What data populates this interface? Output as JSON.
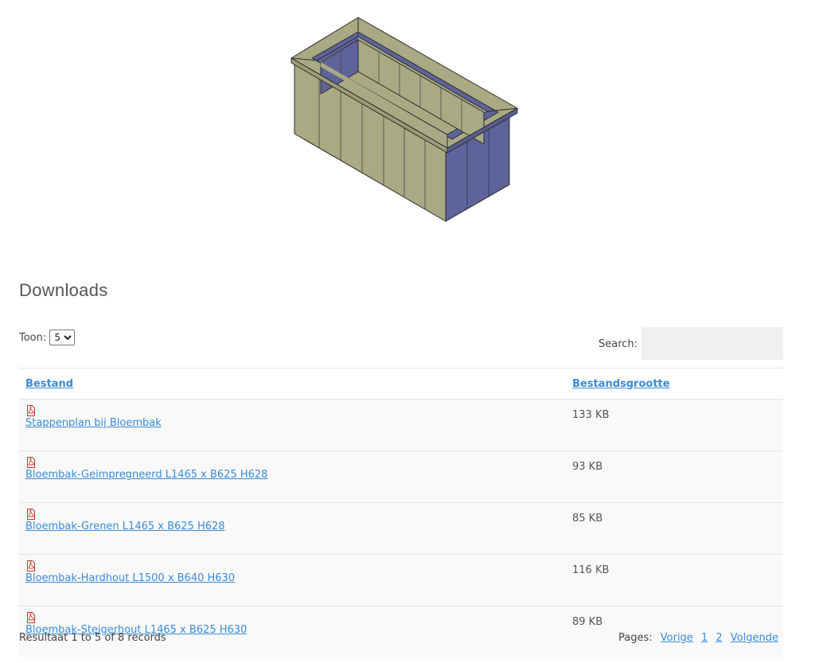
{
  "figure": {
    "name": "bloembak-3d-drawing"
  },
  "section": {
    "title": "Downloads"
  },
  "controls": {
    "toon_label": "Toon:",
    "toon_value": "5",
    "search_label": "Search:",
    "search_placeholder": ""
  },
  "table": {
    "headers": {
      "file": "Bestand",
      "size": "Bestandsgrootte"
    },
    "rows": [
      {
        "name": "Stappenplan bij Bloembak",
        "size": "133 KB",
        "icon": "pdf-icon"
      },
      {
        "name": "Bloembak-Geimpregneerd L1465 x B625 H628",
        "size": "93 KB",
        "icon": "pdf-icon"
      },
      {
        "name": "Bloembak-Grenen L1465 x B625 H628",
        "size": "85 KB",
        "icon": "pdf-icon"
      },
      {
        "name": "Bloembak-Hardhout L1500 x B640 H630",
        "size": "116 KB",
        "icon": "pdf-icon"
      },
      {
        "name": "Bloembak-Steigerhout L1465 x B625 H630",
        "size": "89 KB",
        "icon": "pdf-icon"
      }
    ]
  },
  "footer": {
    "info": "Resultaat 1 to 5 of 8 records",
    "pages_label": "Pages:",
    "prev": "Vorige",
    "page1": "1",
    "page2": "2",
    "next": "Volgende"
  },
  "colors": {
    "link": "#3a8bd6",
    "wood": "#a8a982",
    "inner": "#5f6497",
    "outline": "#2b2b2b"
  }
}
